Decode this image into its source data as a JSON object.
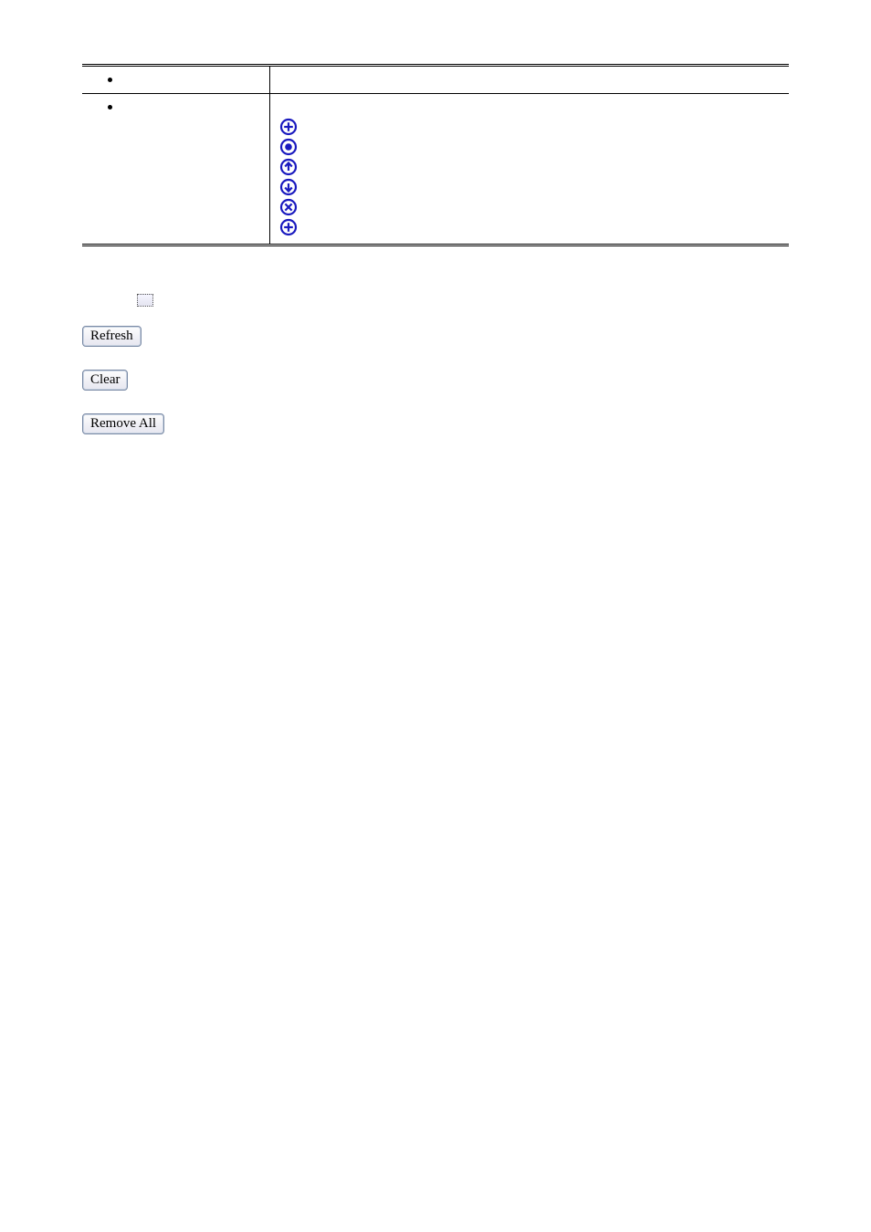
{
  "icons": [
    {
      "name": "plus-icon"
    },
    {
      "name": "record-icon"
    },
    {
      "name": "up-arrow-icon"
    },
    {
      "name": "down-arrow-icon"
    },
    {
      "name": "cross-icon"
    },
    {
      "name": "plus-icon"
    }
  ],
  "buttons": {
    "refresh": "Refresh",
    "clear": "Clear",
    "remove_all": "Remove All"
  }
}
